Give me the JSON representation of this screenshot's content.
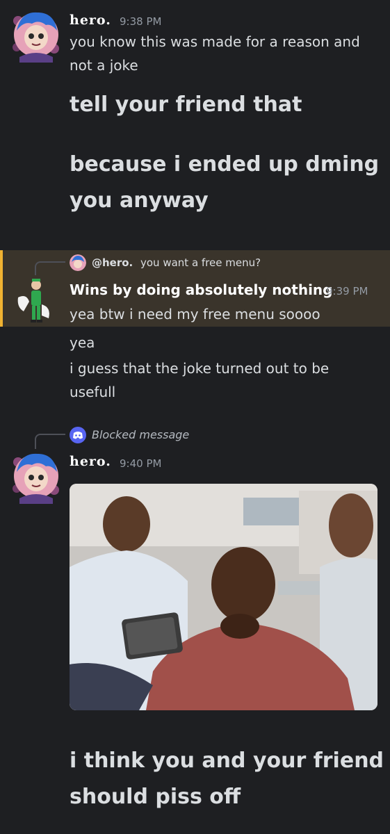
{
  "messages": {
    "first": {
      "author": "hero.",
      "time": "9:38 PM",
      "line1": "you know this was made for a reason and",
      "line2": "not a joke",
      "big1": "tell your friend that",
      "big2": "because i ended up dming",
      "big3": "you anyway"
    },
    "second": {
      "reply_name": "@hero.",
      "reply_text": "you want a free menu?",
      "author": "Wins by doing absolutely nothing",
      "time": "9:39 PM",
      "line1": "yea btw i need my free menu soooo",
      "line2": "yea",
      "line3": "i guess that the joke turned out to be",
      "line4": "usefull"
    },
    "third": {
      "blocked": "Blocked message",
      "author": "hero.",
      "time": "9:40 PM",
      "big1": "i think you and your friend",
      "big2": "should piss off"
    }
  },
  "icons": {
    "hero_avatar": "anime-avatar-icon",
    "wins_avatar": "green-character-avatar-icon",
    "blocked": "discord-logo-icon"
  },
  "colors": {
    "background": "#1e1f22",
    "highlight": "#3a342b",
    "highlight_bar": "#f0b232",
    "text": "#dbdee1",
    "muted": "#949ba4",
    "blurple": "#5865f2"
  }
}
